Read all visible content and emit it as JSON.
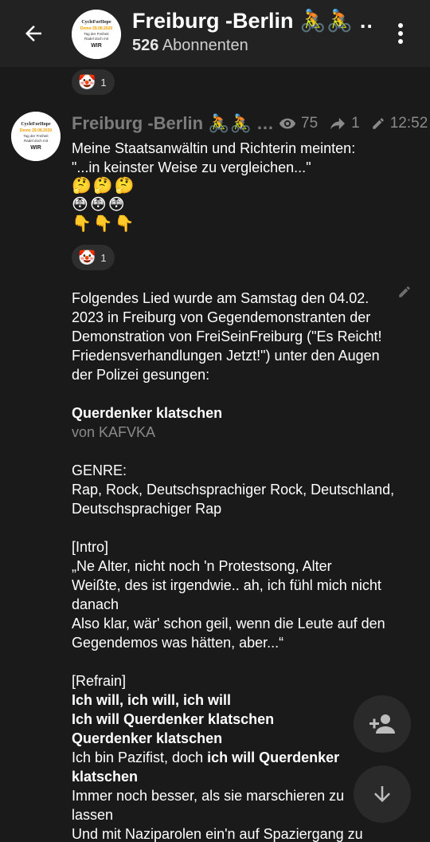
{
  "header": {
    "title": "Freiburg -Berlin 🚴🚴 …",
    "subscribers_count": "526",
    "subscribers_label": "Abonnenten"
  },
  "top_reaction": {
    "emoji": "🤡",
    "count": "1"
  },
  "post": {
    "author": "Freiburg -Berlin 🚴🚴 …",
    "views": "75",
    "forwards": "1",
    "time": "12:52",
    "text_line1": "Meine Staatsanwältin und Richterin meinten:",
    "text_line2": "\"...in keinster Weise zu vergleichen...\"",
    "emoji_rows": [
      [
        "🤔",
        "🤔",
        "🤔"
      ],
      [
        "😳",
        "😳",
        "😳"
      ],
      [
        "👇",
        "👇",
        "👇"
      ]
    ],
    "reaction": {
      "emoji": "🤡",
      "count": "1"
    }
  },
  "message2": {
    "intro_lines": [
      "Folgendes Lied wurde am Samstag den 04.02.",
      "2023 in Freiburg von Gegendemonstranten der",
      "Demonstration von FreiSeinFreiburg (\"Es Reicht!",
      "Friedensverhandlungen Jetzt!\") unter den Augen",
      "der Polizei gesungen:"
    ],
    "song_title": "Querdenker klatschen",
    "song_artist": "von KAFVKA",
    "genre_label": "GENRE:",
    "genre_lines": [
      "Rap, Rock, Deutschsprachiger Rock, Deutschland,",
      "Deutschsprachiger Rap"
    ],
    "intro_tag": "[Intro]",
    "intro_lyrics": [
      "„Ne Alter, nicht noch 'n Protestsong, Alter",
      "Weißte, des ist irgendwie.. ah, ich fühl mich nicht",
      "danach",
      "Also klar, wär' schon geil, wenn die Leute auf den",
      "Gegendemos was hätten, aber...“"
    ],
    "refrain_tag": "[Refrain]",
    "refrain_bold_1": "Ich will, ich will, ich will",
    "refrain_bold_2": "Ich will Querdenker klatschen",
    "refrain_bold_3": "Querdenker klatschen",
    "refrain_mixed_normal": "Ich bin Pazifist, doch ",
    "refrain_mixed_bold": "ich will Querdenker",
    "refrain_bold_4": "klatschen",
    "refrain_lines_end": [
      "Immer noch besser, als sie marschieren zu",
      "lassen",
      "Und mit Naziparolen ein'n auf Spaziergang zu"
    ]
  },
  "avatar_logo": {
    "line1": "CycleForHope",
    "line2": "Demo 29.08.2020",
    "line3": "Tag der Freiheit",
    "line4": "Radel doch mit",
    "line5": "WIR"
  },
  "colors": {
    "accent": "#ffb000",
    "background": "#1a1a1a",
    "header": "#222222"
  }
}
